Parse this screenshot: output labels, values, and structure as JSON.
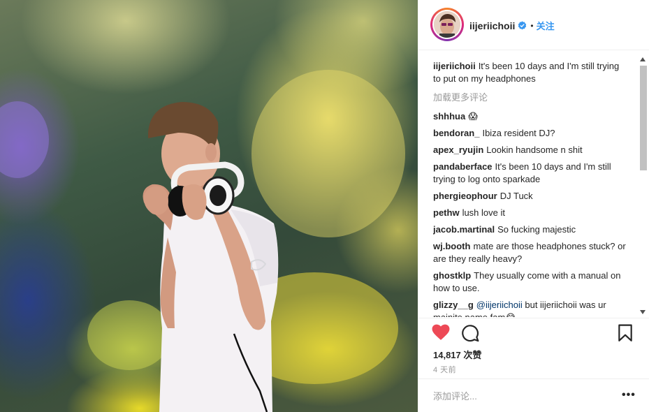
{
  "post": {
    "image_alt": "young man in white t-shirt wearing headphones in colored smoke",
    "header": {
      "username": "iijeriichoii",
      "verified": true,
      "separator": "•",
      "follow_label": "关注"
    },
    "caption": {
      "user": "iijeriichoii",
      "text": "It's been 10 days and I'm still trying to put on my headphones"
    },
    "load_more_label": "加载更多评论",
    "comments": [
      {
        "user": "shhhua",
        "text": "😱"
      },
      {
        "user": "bendoran_",
        "text": "Ibiza resident DJ?"
      },
      {
        "user": "apex_ryujin",
        "text": "Lookin handsome n shit"
      },
      {
        "user": "pandaberface",
        "text": "It's been 10 days and I'm still trying to log onto sparkade"
      },
      {
        "user": "phergieophour",
        "text": "DJ Tuck"
      },
      {
        "user": "pethw",
        "text": "lush love it"
      },
      {
        "user": "jacob.martinal",
        "text": "So fucking majestic"
      },
      {
        "user": "wj.booth",
        "text": "mate are those headphones stuck? or are they really heavy?"
      },
      {
        "user": "ghostklp",
        "text": "They usually come with a manual on how to use."
      },
      {
        "user": "glizzy__g",
        "mention": "@iijeriichoii",
        "text": "but iijeriichoii was ur majnite name fam😂"
      }
    ],
    "likes_text": "14,817 次赞",
    "time_text": "4 天前",
    "add_comment_placeholder": "添加评论...",
    "more_options": "•••"
  },
  "colors": {
    "heart": "#ed4956",
    "link": "#3897f0",
    "muted": "#999999",
    "text": "#262626"
  },
  "icons": {
    "heart": "heart-filled-icon",
    "comment": "comment-bubble-icon",
    "save": "bookmark-icon",
    "verified": "verified-badge-icon"
  }
}
